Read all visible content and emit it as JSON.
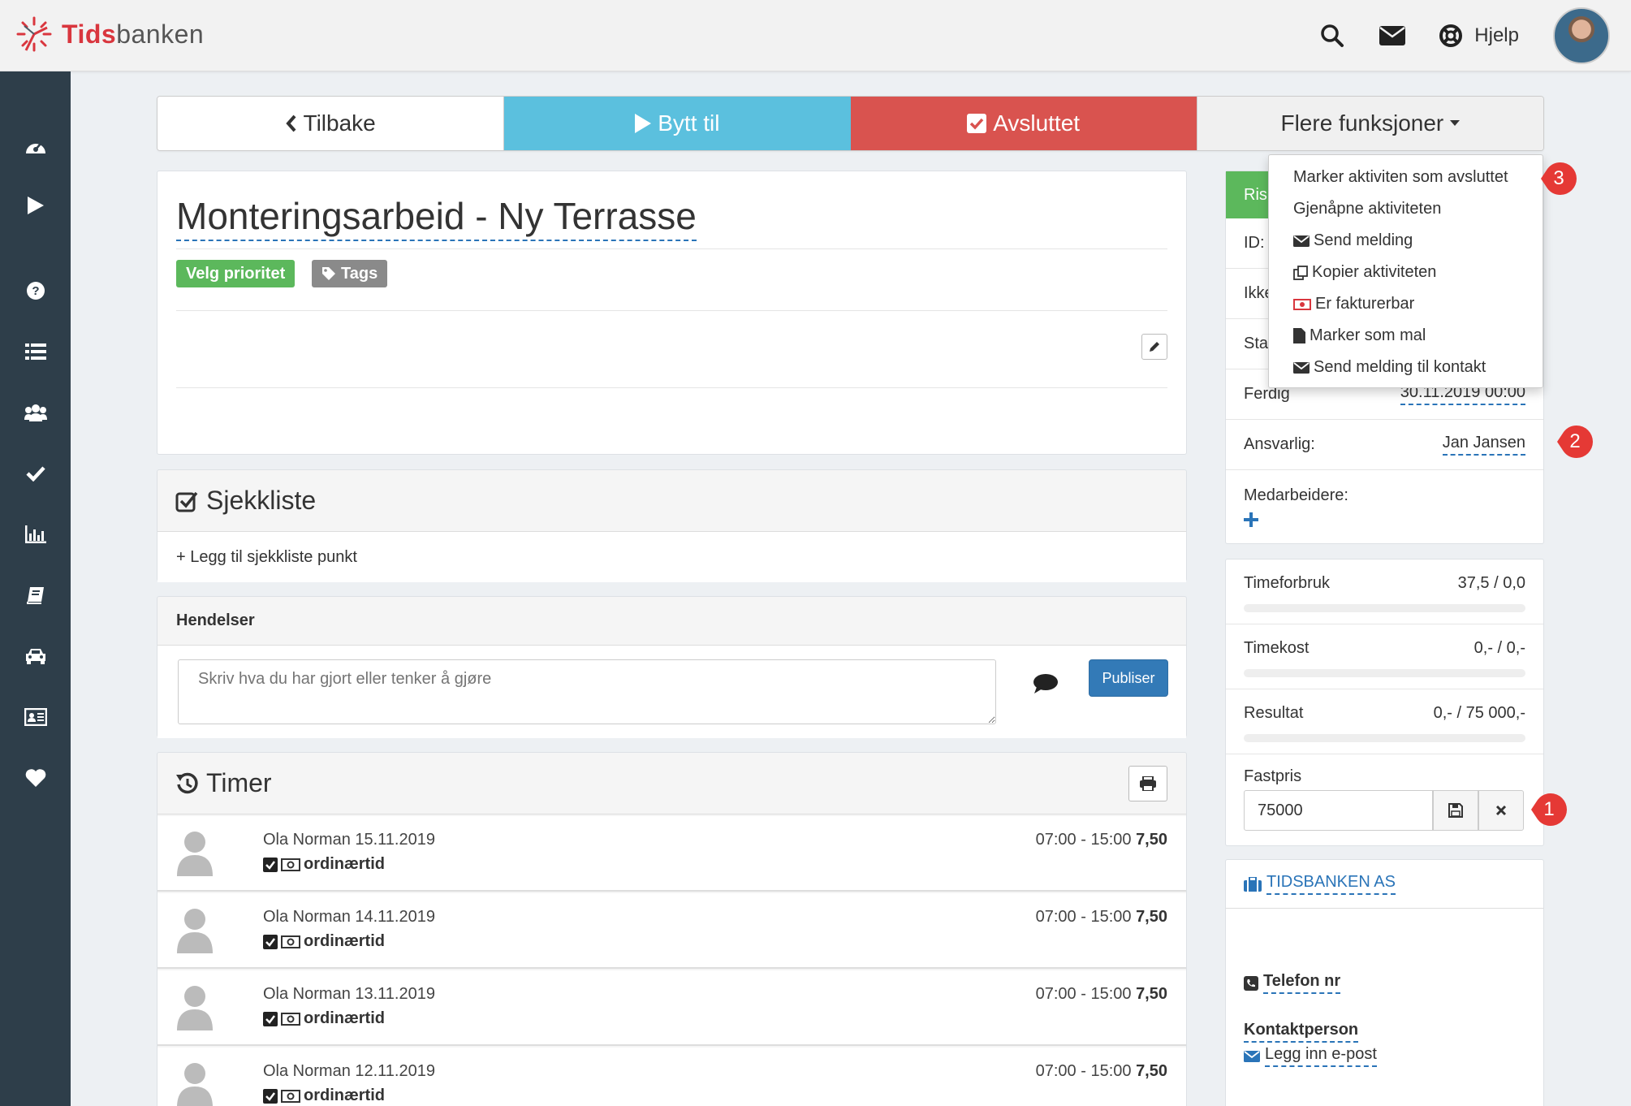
{
  "app": {
    "brand_a": "Tids",
    "brand_b": "banken",
    "accent": "#d9363e"
  },
  "topbar": {
    "help_label": "Hjelp",
    "icons": [
      "search-icon",
      "envelope-icon",
      "life-ring-icon"
    ]
  },
  "sidebar": {
    "icons": [
      "dashboard-icon",
      "play-icon",
      "question-icon",
      "list-icon",
      "users-icon",
      "check-icon",
      "bar-chart-icon",
      "book-icon",
      "car-icon",
      "id-card-icon",
      "heart-icon"
    ]
  },
  "actions": {
    "back": "Tilbake",
    "switch": "Bytt til",
    "done": "Avsluttet",
    "more": "Flere funksjoner"
  },
  "activity": {
    "title": "Monteringsarbeid - Ny Terrasse",
    "priority_label": "Velg prioritet",
    "tags_label": "Tags"
  },
  "checklist": {
    "title": "Sjekkliste",
    "add_label": "+ Legg til sjekkliste punkt"
  },
  "events": {
    "title": "Hendelser",
    "placeholder": "Skriv hva du har gjort eller tenker å gjøre",
    "publish_label": "Publiser"
  },
  "timer": {
    "title": "Timer",
    "rows": [
      {
        "name": "Ola Norman 15.11.2019",
        "type": "ordinærtid",
        "range": "07:00 - 15:00",
        "hours": "7,50"
      },
      {
        "name": "Ola Norman 14.11.2019",
        "type": "ordinærtid",
        "range": "07:00 - 15:00",
        "hours": "7,50"
      },
      {
        "name": "Ola Norman 13.11.2019",
        "type": "ordinærtid",
        "range": "07:00 - 15:00",
        "hours": "7,50"
      },
      {
        "name": "Ola Norman 12.11.2019",
        "type": "ordinærtid",
        "range": "07:00 - 15:00",
        "hours": "7,50"
      }
    ]
  },
  "status": {
    "strip_label": "Ris",
    "id_label": "ID:",
    "ikke_label": "Ikke",
    "start_label": "Sta",
    "finish_label": "Ferdig",
    "finish_value": "30.11.2019 00:00",
    "responsible_label": "Ansvarlig:",
    "responsible_value": "Jan Jansen",
    "coworkers_label": "Medarbeidere:"
  },
  "stats": {
    "hours_label": "Timeforbruk",
    "hours_value": "37,5 / 0,0",
    "cost_label": "Timekost",
    "cost_value": "0,- / 0,-",
    "result_label": "Resultat",
    "result_value": "0,- / 75 000,-",
    "fixed_label": "Fastpris",
    "fixed_value": "75000"
  },
  "company": {
    "name": "TIDSBANKEN AS",
    "phone_label": "Telefon nr",
    "contact_label": "Kontaktperson",
    "email_label": "Legg inn e-post"
  },
  "dropdown": {
    "items": [
      "Marker aktiviten som avsluttet",
      "Gjenåpne aktiviteten",
      "Send melding",
      "Kopier aktiviteten",
      "Er fakturerbar",
      "Marker som mal",
      "Send melding til kontakt"
    ]
  },
  "callouts": [
    "3",
    "2",
    "1"
  ]
}
